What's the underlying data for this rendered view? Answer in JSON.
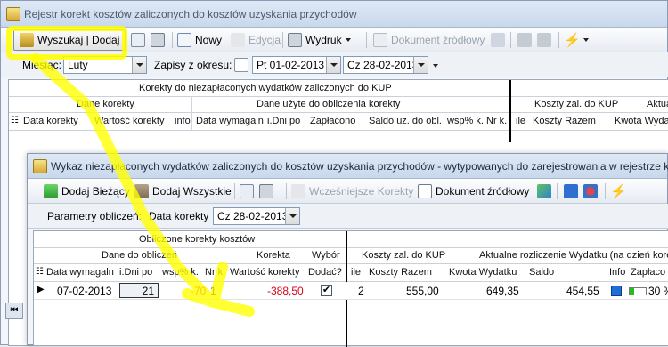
{
  "main_window": {
    "title": "Rejestr korekt kosztów zaliczonych do kosztów uzyskania przychodów",
    "toolbar": {
      "search_add": "Wyszukaj | Dodaj",
      "new": "Nowy",
      "edit": "Edycja",
      "print": "Wydruk",
      "source_document": "Dokument źródłowy"
    },
    "filter": {
      "month_label": "Miesiąc:",
      "month_value": "Luty",
      "period_label": "Zapisy z okresu:",
      "date_from": "Pt 01-02-2013",
      "date_to": "Cz 28-02-2013"
    },
    "grid": {
      "band_top": "Korekty do niezapłaconych wydatków zaliczonych do KUP",
      "group_corrections": "Dane korekty",
      "group_used": "Dane użyte do obliczenia korekty",
      "group_costs": "Koszty zal. do KUP",
      "group_current": "Aktualne",
      "columns": [
        "Data korekty",
        "Wartość korekty",
        "info",
        "Data wymagaln",
        "i.Dni po",
        "Zapłacono",
        "Saldo uż. do obl.",
        "wsp% k.",
        "Nr k.",
        "ile",
        "Koszty Razem",
        "Kwota Wydatk"
      ]
    }
  },
  "child_window": {
    "title": "Wykaz niezapłaconych wydatków zaliczonych do kosztów uzyskania przychodów - wytypowanych do zarejestrowania w rejestrze k",
    "toolbar": {
      "add_current": "Dodaj Bieżący",
      "add_all": "Dodaj Wszystkie",
      "earlier_corrections": "Wcześniejsze Korekty",
      "source_document": "Dokument źródłowy"
    },
    "params": {
      "label": "Parametry obliczeń:",
      "date_label": "Data korekty",
      "date_value": "Cz 28-02-2013"
    },
    "grid": {
      "band_top": "Obliczone korekty kosztów",
      "group_calc": "Dane do obliczeń",
      "group_correction": "Korekta",
      "group_choice": "Wybór",
      "group_costs": "Koszty zal. do KUP",
      "group_current": "Aktualne rozliczenie Wydatku (na dzień korek",
      "columns": [
        "Data wymagaln",
        "i.Dni po",
        "wsp% k.",
        "Nr k.",
        "Wartość korekty",
        "Dodać?",
        "ile",
        "Koszty Razem",
        "Kwota Wydatku",
        "Saldo",
        "Info",
        "Zapłaco"
      ],
      "row": {
        "date_due": "07-02-2013",
        "days_after": "21",
        "coef": "-70",
        "nr": "1",
        "correction_value": "-388,50",
        "add_checked": true,
        "count": "2",
        "costs_total": "555,00",
        "expense_amount": "649,35",
        "balance": "454,55",
        "paid_pct": "30 %"
      }
    }
  },
  "colors": {
    "highlight": "#ffff00",
    "negative_value": "#d8001a",
    "info_square": "#1f6fd6",
    "progress_green": "#20c020"
  }
}
